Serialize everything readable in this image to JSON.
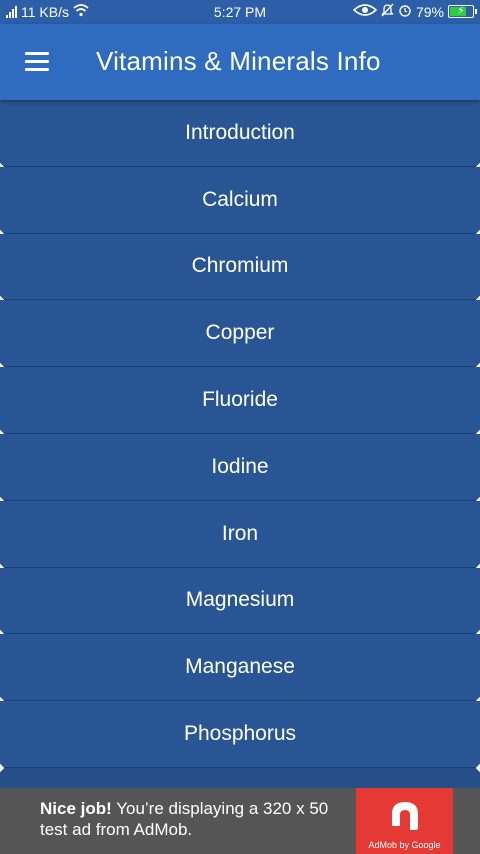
{
  "statusbar": {
    "network_speed": "11 KB/s",
    "time": "5:27 PM",
    "battery": "79%",
    "battery_level": 0.79
  },
  "appbar": {
    "title": "Vitamins & Minerals Info"
  },
  "list": {
    "items": [
      "Introduction",
      "Calcium",
      "Chromium",
      "Copper",
      "Fluoride",
      "Iodine",
      "Iron",
      "Magnesium",
      "Manganese",
      "Phosphorus"
    ]
  },
  "ad": {
    "headline": "Nice job!",
    "body": " You’re displaying a 320 x 50 test ad from AdMob.",
    "brand": "AdMob by Google"
  },
  "colors": {
    "appbar": "#2f6cc0",
    "list_bg": "#2a5594",
    "ad_bg": "#555555",
    "ad_logo": "#e53935"
  }
}
